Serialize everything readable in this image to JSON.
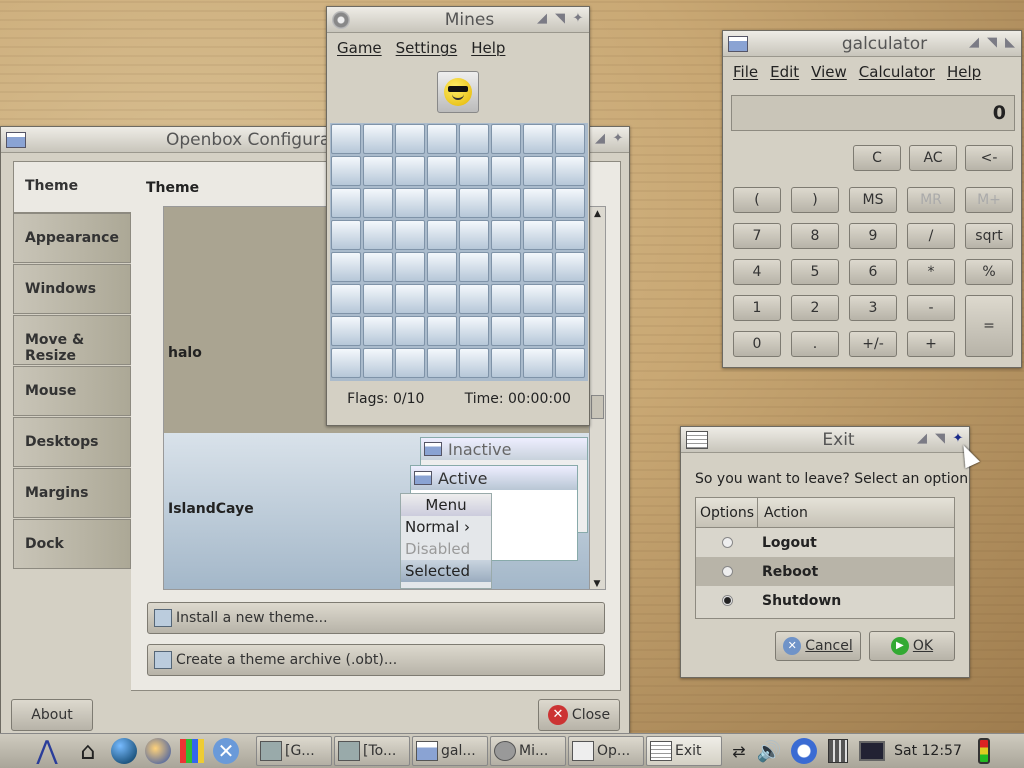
{
  "openbox": {
    "title": "Openbox Configurat",
    "tabs": [
      "Theme",
      "Appearance",
      "Windows",
      "Move & Resize",
      "Mouse",
      "Desktops",
      "Margins",
      "Dock"
    ],
    "theme_header": "Theme",
    "themes": [
      "halo",
      "IslandCaye"
    ],
    "preview": {
      "inactive": "Inactive",
      "active": "Active",
      "menu_title": "Menu",
      "menu_items": [
        "Normal",
        "Disabled",
        "Selected"
      ]
    },
    "install_label": "Install a new theme...",
    "archive_label": "Create a theme archive (.obt)...",
    "about_label": "About",
    "close_label": "Close"
  },
  "mines": {
    "title": "Mines",
    "menu": [
      "Game",
      "Settings",
      "Help"
    ],
    "flags": "Flags: 0/10",
    "time": "Time: 00:00:00"
  },
  "calc": {
    "title": "galculator",
    "menu": [
      "File",
      "Edit",
      "View",
      "Calculator",
      "Help"
    ],
    "display": "0",
    "row0": [
      "C",
      "AC",
      "<-"
    ],
    "row1": [
      "(",
      ")",
      "MS",
      "MR",
      "M+"
    ],
    "row2": [
      "7",
      "8",
      "9",
      "/",
      "sqrt"
    ],
    "row3": [
      "4",
      "5",
      "6",
      "*",
      "%"
    ],
    "row4": [
      "1",
      "2",
      "3",
      "-"
    ],
    "row5": [
      "0",
      ".",
      "+/-",
      "+"
    ],
    "equals": "="
  },
  "exit": {
    "title": "Exit",
    "prompt": "So you want to leave?  Select an option",
    "col_options": "Options",
    "col_action": "Action",
    "actions": [
      "Logout",
      "Reboot",
      "Shutdown"
    ],
    "selected": 2,
    "cancel_label": "Cancel",
    "ok_label": "OK"
  },
  "taskbar": {
    "tasks": [
      "[G...",
      "[To...",
      "gal...",
      "Mi...",
      "Op...",
      "Exit"
    ],
    "clock": "Sat 12:57"
  }
}
